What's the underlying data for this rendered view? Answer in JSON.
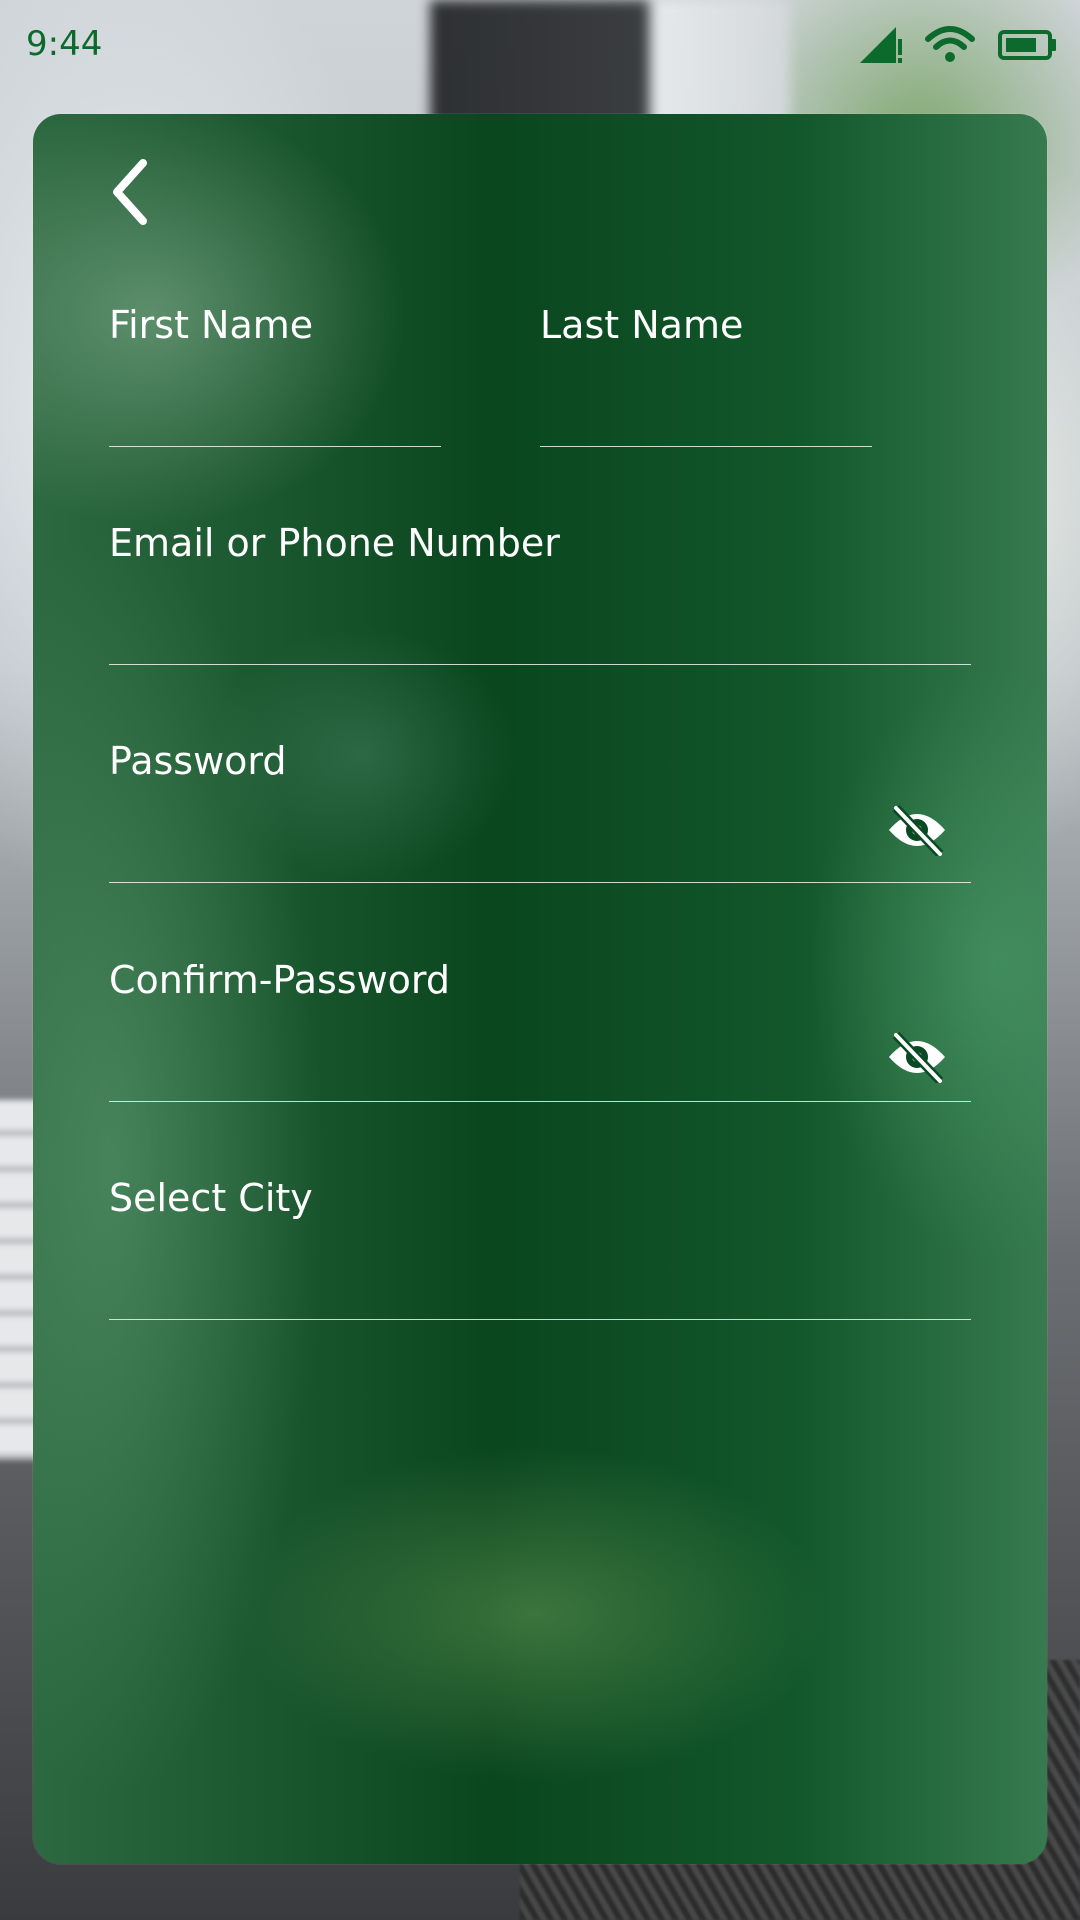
{
  "status_bar": {
    "time": "9:44",
    "icons": [
      "signal-alert-icon",
      "wifi-icon",
      "battery-icon"
    ],
    "color": "#0b6a2c"
  },
  "form": {
    "back_icon": "chevron-left-icon",
    "first_name": {
      "label": "First Name",
      "value": ""
    },
    "last_name": {
      "label": "Last Name",
      "value": ""
    },
    "email_phone": {
      "label": "Email or Phone Number",
      "value": ""
    },
    "password": {
      "label": "Password",
      "value": "",
      "toggle_icon": "eye-off-icon"
    },
    "confirm_password": {
      "label": "Confirm-Password",
      "value": "",
      "toggle_icon": "eye-off-icon"
    },
    "city": {
      "label": "Select City",
      "value": ""
    }
  },
  "colors": {
    "card_green": "#07451d",
    "text": "#ffffff",
    "underline": "#e6f0e9"
  }
}
